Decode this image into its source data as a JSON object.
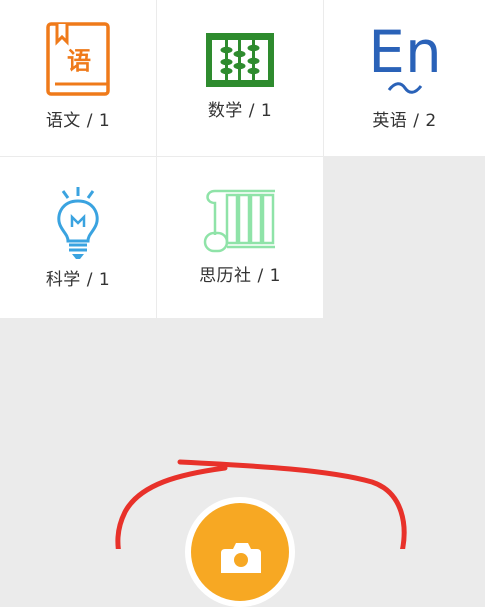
{
  "subjects": [
    {
      "name": "语文",
      "count": "1",
      "label": "语文 / 1",
      "icon": "book-icon",
      "color": "#ef7a1a"
    },
    {
      "name": "数学",
      "count": "1",
      "label": "数学 / 1",
      "icon": "abacus-icon",
      "color": "#2e8b2e"
    },
    {
      "name": "英语",
      "count": "2",
      "label": "英语 / 2",
      "icon": "english-en-icon",
      "color": "#2a62b8"
    },
    {
      "name": "科学",
      "count": "1",
      "label": "科学 / 1",
      "icon": "lightbulb-icon",
      "color": "#3aa3e0"
    },
    {
      "name": "思历社",
      "count": "1",
      "label": "思历社 / 1",
      "icon": "scroll-icon",
      "color": "#8fe3a8"
    }
  ],
  "book_icon_glyph": "语",
  "english_icon_text": "En",
  "camera_button": {
    "icon": "camera-icon",
    "color": "#f7a823"
  },
  "annotation": {
    "type": "red-circle",
    "color": "#e8312a"
  }
}
